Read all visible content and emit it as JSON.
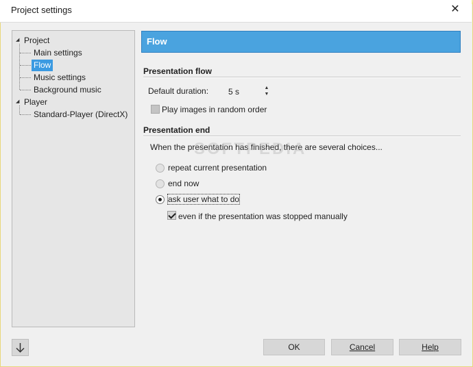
{
  "window": {
    "title": "Project settings",
    "close_glyph": "✕"
  },
  "tree": {
    "items": [
      {
        "label": "Project",
        "level": 0,
        "expanded": true
      },
      {
        "label": "Main settings",
        "level": 1
      },
      {
        "label": "Flow",
        "level": 1,
        "selected": true
      },
      {
        "label": "Music settings",
        "level": 1
      },
      {
        "label": "Background music",
        "level": 1
      },
      {
        "label": "Player",
        "level": 0,
        "expanded": true
      },
      {
        "label": "Standard-Player (DirectX)",
        "level": 1
      }
    ],
    "expander_glyph": "◢"
  },
  "panel": {
    "header": "Flow",
    "presentation_flow": {
      "title": "Presentation flow",
      "duration_label": "Default duration:",
      "duration_value": "5 s",
      "random_label": "Play images in random order",
      "random_checked": false
    },
    "presentation_end": {
      "title": "Presentation end",
      "description": "When the presentation has finished, there are several choices...",
      "options": [
        {
          "label": "repeat current presentation",
          "checked": false
        },
        {
          "label": "end now",
          "checked": false
        },
        {
          "label": "ask user what to do",
          "checked": true
        }
      ],
      "even_if_label": "even if the presentation was stopped manually",
      "even_if_checked": true
    },
    "watermark": "SOFTPEDIA"
  },
  "footer": {
    "down_glyph": "🡣",
    "ok": "OK",
    "cancel": "Cancel",
    "help": "Help"
  },
  "colors": {
    "accent": "#4aa3df",
    "selection": "#3b9ae1",
    "frame": "#f5ecab"
  }
}
